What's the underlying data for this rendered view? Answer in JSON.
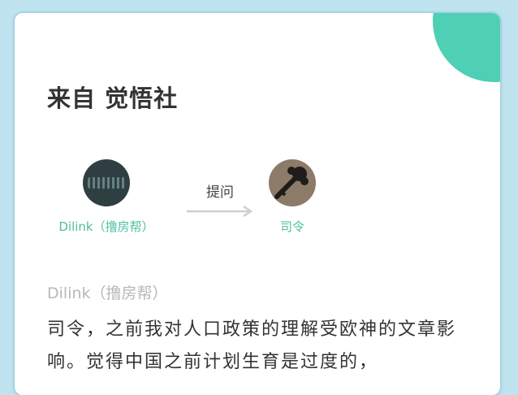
{
  "header": {
    "title": "来自 觉悟社"
  },
  "flow": {
    "from_user": {
      "name": "Dilink（撸房帮）"
    },
    "action": "提问",
    "to_user": {
      "name": "司令"
    }
  },
  "question": {
    "author": "Dilink（撸房帮）",
    "text": "司令，之前我对人口政策的理解受欧神的文章影响。觉得中国之前计划生育是过度的，"
  },
  "colors": {
    "accent": "#4fcfb3",
    "name_green": "#4fbfa2",
    "muted": "#b8b8b8"
  }
}
